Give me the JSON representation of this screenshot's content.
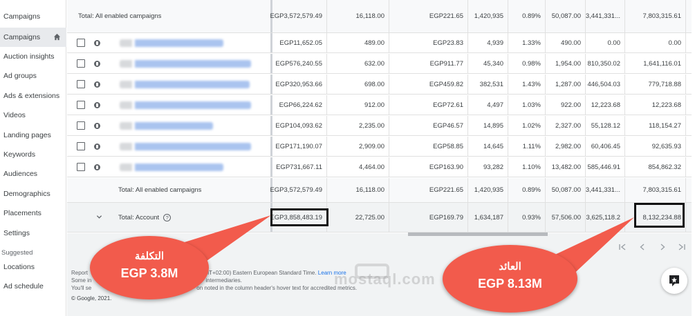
{
  "sidebar": {
    "items": [
      {
        "label": "Campaigns"
      },
      {
        "label": "Campaigns"
      },
      {
        "label": "Auction insights"
      },
      {
        "label": "Ad groups"
      },
      {
        "label": "Ads & extensions"
      },
      {
        "label": "Videos"
      },
      {
        "label": "Landing pages"
      },
      {
        "label": "Keywords"
      },
      {
        "label": "Audiences"
      },
      {
        "label": "Demographics"
      },
      {
        "label": "Placements"
      },
      {
        "label": "Settings"
      }
    ],
    "suggested_label": "Suggested",
    "suggested_items": [
      {
        "label": "Locations"
      },
      {
        "label": "Ad schedule"
      }
    ]
  },
  "table": {
    "total_top": {
      "label": "Total: All enabled campaigns",
      "cost": "EGP3,572,579.49",
      "impr": "16,118.00",
      "cpc": "EGP221.65",
      "interactions": "1,420,935",
      "rate": "0.89%",
      "conv": "50,087.00",
      "conv_value": "3,441,331...",
      "return": "7,803,315.61"
    },
    "rows": [
      {
        "cost": "EGP11,652.05",
        "impr": "489.00",
        "cpc": "EGP23.83",
        "interactions": "4,939",
        "rate": "1.33%",
        "conv": "490.00",
        "conv_value": "0.00",
        "return": "0.00",
        "name_w": 150
      },
      {
        "cost": "EGP576,240.55",
        "impr": "632.00",
        "cpc": "EGP911.77",
        "interactions": "45,340",
        "rate": "0.98%",
        "conv": "1,954.00",
        "conv_value": "810,350.02",
        "return": "1,641,116.01",
        "name_w": 190
      },
      {
        "cost": "EGP320,953.66",
        "impr": "698.00",
        "cpc": "EGP459.82",
        "interactions": "382,531",
        "rate": "1.43%",
        "conv": "1,287.00",
        "conv_value": "446,504.03",
        "return": "779,718.88",
        "name_w": 188
      },
      {
        "cost": "EGP66,224.62",
        "impr": "912.00",
        "cpc": "EGP72.61",
        "interactions": "4,497",
        "rate": "1.03%",
        "conv": "922.00",
        "conv_value": "12,223.68",
        "return": "12,223.68",
        "name_w": 190
      },
      {
        "cost": "EGP104,093.62",
        "impr": "2,235.00",
        "cpc": "EGP46.57",
        "interactions": "14,895",
        "rate": "1.02%",
        "conv": "2,327.00",
        "conv_value": "55,128.12",
        "return": "118,154.27",
        "name_w": 135
      },
      {
        "cost": "EGP171,190.07",
        "impr": "2,909.00",
        "cpc": "EGP58.85",
        "interactions": "14,645",
        "rate": "1.11%",
        "conv": "2,982.00",
        "conv_value": "60,406.45",
        "return": "92,635.93",
        "name_w": 190
      },
      {
        "cost": "EGP731,667.11",
        "impr": "4,464.00",
        "cpc": "EGP163.90",
        "interactions": "93,282",
        "rate": "1.10%",
        "conv": "13,482.00",
        "conv_value": "585,446.91",
        "return": "854,862.32",
        "name_w": 150
      }
    ],
    "total_mid": {
      "label": "Total: All enabled campaigns",
      "cost": "EGP3,572,579.49",
      "impr": "16,118.00",
      "cpc": "EGP221.65",
      "interactions": "1,420,935",
      "rate": "0.89%",
      "conv": "50,087.00",
      "conv_value": "3,441,331...",
      "return": "7,803,315.61"
    },
    "account": {
      "label": "Total: Account",
      "cost": "EGP3,858,483.19",
      "impr": "22,725.00",
      "cpc": "EGP169.79",
      "interactions": "1,634,187",
      "rate": "0.93%",
      "conv": "57,506.00",
      "conv_value": "3,625,118.2",
      "return": "8,132,234.88"
    }
  },
  "footer": {
    "line1_a": "Report",
    "line1_b": "times: (GMT+02:00) Eastern European Standard Time.",
    "line1_link": "Learn more",
    "line2_a": "Some in",
    "line2_b": "intermediaries.",
    "line3_a": "You'll se",
    "line3_b": "on noted in the column header's hover text for accredited metrics.",
    "copyright": "© Google, 2021."
  },
  "callouts": {
    "cost_title": "التكلفة",
    "cost_value": "EGP 3.8M",
    "return_title": "العائد",
    "return_value": "EGP 8.13M"
  },
  "watermark": "mostaql.com",
  "colors": {
    "callout": "#f25b4c",
    "link": "#1a73e8"
  }
}
